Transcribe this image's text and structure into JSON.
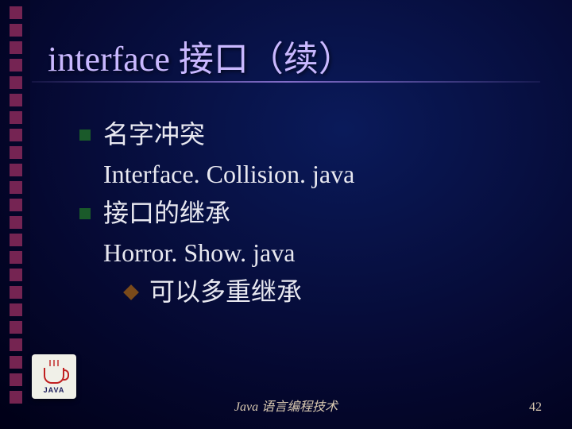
{
  "title": "interface 接口（续）",
  "bullets": [
    {
      "heading": "名字冲突",
      "body": "Interface. Collision. java"
    },
    {
      "heading": "接口的继承",
      "body": "Horror. Show. java",
      "sub": [
        "可以多重继承"
      ]
    }
  ],
  "footer": "Java 语言编程技术",
  "page_number": "42",
  "logo_text": "JAVA",
  "strip_count": 23
}
